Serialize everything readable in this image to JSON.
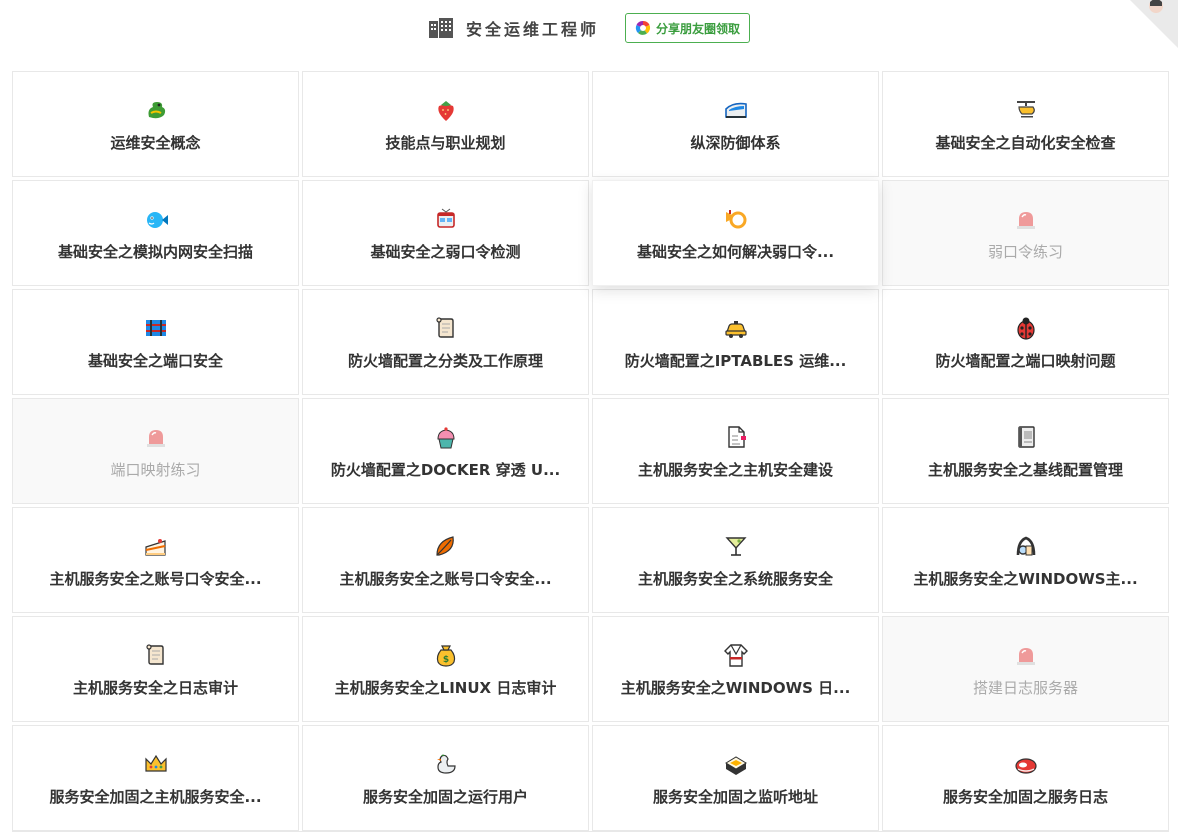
{
  "header": {
    "title": "安全运维工程师",
    "share_label": "分享朋友圈领取",
    "title_icon": "office-building-icon"
  },
  "colors": {
    "accent_green": "#3a9d3e",
    "locked_bg": "#f9f9f9",
    "border": "#e8e8e8"
  },
  "cards": [
    {
      "label": "运维安全概念",
      "icon": "dragon-icon",
      "locked": false
    },
    {
      "label": "技能点与职业规划",
      "icon": "strawberry-icon",
      "locked": false
    },
    {
      "label": "纵深防御体系",
      "icon": "bullet-train-icon",
      "locked": false
    },
    {
      "label": "基础安全之自动化安全检查",
      "icon": "helicopter-icon",
      "locked": false
    },
    {
      "label": "基础安全之模拟内网安全扫描",
      "icon": "blowfish-icon",
      "locked": false
    },
    {
      "label": "基础安全之弱口令检测",
      "icon": "tram-icon",
      "locked": false
    },
    {
      "label": "基础安全之如何解决弱口令...",
      "icon": "postal-horn-icon",
      "locked": false,
      "hover": true
    },
    {
      "label": "弱口令练习",
      "icon": "rotating-light-icon",
      "locked": true
    },
    {
      "label": "基础安全之端口安全",
      "icon": "railway-icon",
      "locked": false
    },
    {
      "label": "防火墙配置之分类及工作原理",
      "icon": "scroll-icon",
      "locked": false
    },
    {
      "label": "防火墙配置之IPTABLES 运维...",
      "icon": "taxi-icon",
      "locked": false
    },
    {
      "label": "防火墙配置之端口映射问题",
      "icon": "ladybug-icon",
      "locked": false
    },
    {
      "label": "端口映射练习",
      "icon": "rotating-light-icon",
      "locked": true
    },
    {
      "label": "防火墙配置之DOCKER 穿透 U...",
      "icon": "cupcake-icon",
      "locked": false
    },
    {
      "label": "主机服务安全之主机安全建设",
      "icon": "page-icon",
      "locked": false
    },
    {
      "label": "主机服务安全之基线配置管理",
      "icon": "notebook-icon",
      "locked": false
    },
    {
      "label": "主机服务安全之账号口令安全...",
      "icon": "cake-icon",
      "locked": false
    },
    {
      "label": "主机服务安全之账号口令安全...",
      "icon": "fallen-leaf-icon",
      "locked": false
    },
    {
      "label": "主机服务安全之系统服务安全",
      "icon": "cocktail-icon",
      "locked": false
    },
    {
      "label": "主机服务安全之WINDOWS主...",
      "icon": "detective-icon",
      "locked": false
    },
    {
      "label": "主机服务安全之日志审计",
      "icon": "scroll-icon",
      "locked": false
    },
    {
      "label": "主机服务安全之LINUX 日志审计",
      "icon": "money-bag-icon",
      "locked": false
    },
    {
      "label": "主机服务安全之WINDOWS 日...",
      "icon": "martial-arts-uniform-icon",
      "locked": false
    },
    {
      "label": "搭建日志服务器",
      "icon": "rotating-light-icon",
      "locked": true
    },
    {
      "label": "服务安全加固之主机服务安全...",
      "icon": "crown-icon",
      "locked": false
    },
    {
      "label": "服务安全加固之运行用户",
      "icon": "duck-icon",
      "locked": false
    },
    {
      "label": "服务安全加固之监听地址",
      "icon": "sushi-icon",
      "locked": false
    },
    {
      "label": "服务安全加固之服务日志",
      "icon": "meat-icon",
      "locked": false
    }
  ]
}
